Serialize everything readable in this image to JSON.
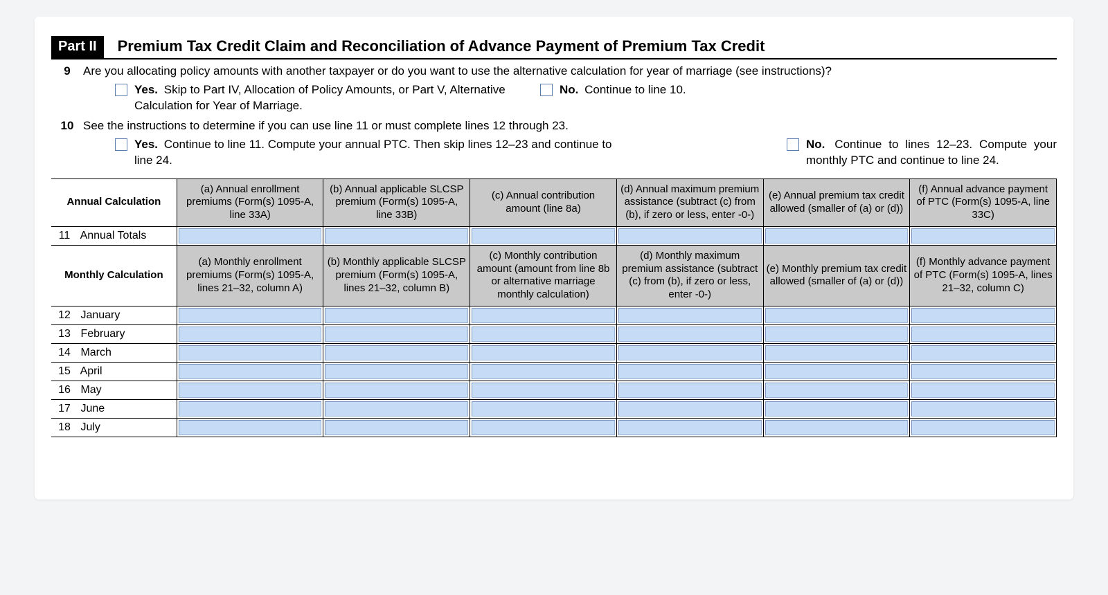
{
  "part": {
    "badge": "Part II",
    "title": "Premium Tax Credit Claim and Reconciliation of Advance Payment of Premium Tax Credit"
  },
  "q9": {
    "num": "9",
    "text": "Are you allocating policy amounts with another taxpayer or do you want to use the alternative calculation for year of marriage (see instructions)?",
    "yes_b": "Yes.",
    "yes_t": "Skip to Part IV, Allocation of Policy Amounts, or Part V, Alternative Calculation for Year of Marriage.",
    "no_b": "No.",
    "no_t": "Continue to line 10."
  },
  "q10": {
    "num": "10",
    "text": "See the instructions to determine if you can use line 11 or must complete lines 12 through 23.",
    "yes_b": "Yes.",
    "yes_t": "Continue to line 11. Compute your annual PTC. Then skip lines 12–23 and continue to line 24.",
    "no_b": "No.",
    "no_t": "Continue to lines 12–23. Compute your monthly PTC and continue to line 24."
  },
  "annual_header": {
    "corner": "Annual Calculation",
    "a": "(a) Annual enrollment premiums (Form(s) 1095-A, line 33A)",
    "b": "(b) Annual applicable SLCSP premium (Form(s) 1095-A, line 33B)",
    "c": "(c) Annual contribution amount (line 8a)",
    "d": "(d) Annual maximum premium assistance (subtract (c) from (b), if zero or less, enter -0-)",
    "e": "(e) Annual premium tax credit allowed (smaller of (a) or (d))",
    "f": "(f) Annual advance payment of PTC (Form(s) 1095-A, line 33C)"
  },
  "row11": {
    "num": "11",
    "label": "Annual Totals"
  },
  "monthly_header": {
    "corner": "Monthly Calculation",
    "a": "(a) Monthly enrollment premiums (Form(s) 1095-A, lines 21–32, column A)",
    "b": "(b) Monthly applicable SLCSP premium (Form(s) 1095-A, lines 21–32, column B)",
    "c": "(c) Monthly contribution amount (amount from line 8b or alternative marriage monthly calculation)",
    "d": "(d) Monthly maximum premium assistance (subtract (c) from (b), if zero or less, enter -0-)",
    "e": "(e) Monthly premium tax credit allowed (smaller of (a) or (d))",
    "f": "(f) Monthly advance payment of PTC (Form(s) 1095-A, lines 21–32, column C)"
  },
  "months": [
    {
      "num": "12",
      "label": "January"
    },
    {
      "num": "13",
      "label": "February"
    },
    {
      "num": "14",
      "label": "March"
    },
    {
      "num": "15",
      "label": "April"
    },
    {
      "num": "16",
      "label": "May"
    },
    {
      "num": "17",
      "label": "June"
    },
    {
      "num": "18",
      "label": "July"
    }
  ]
}
